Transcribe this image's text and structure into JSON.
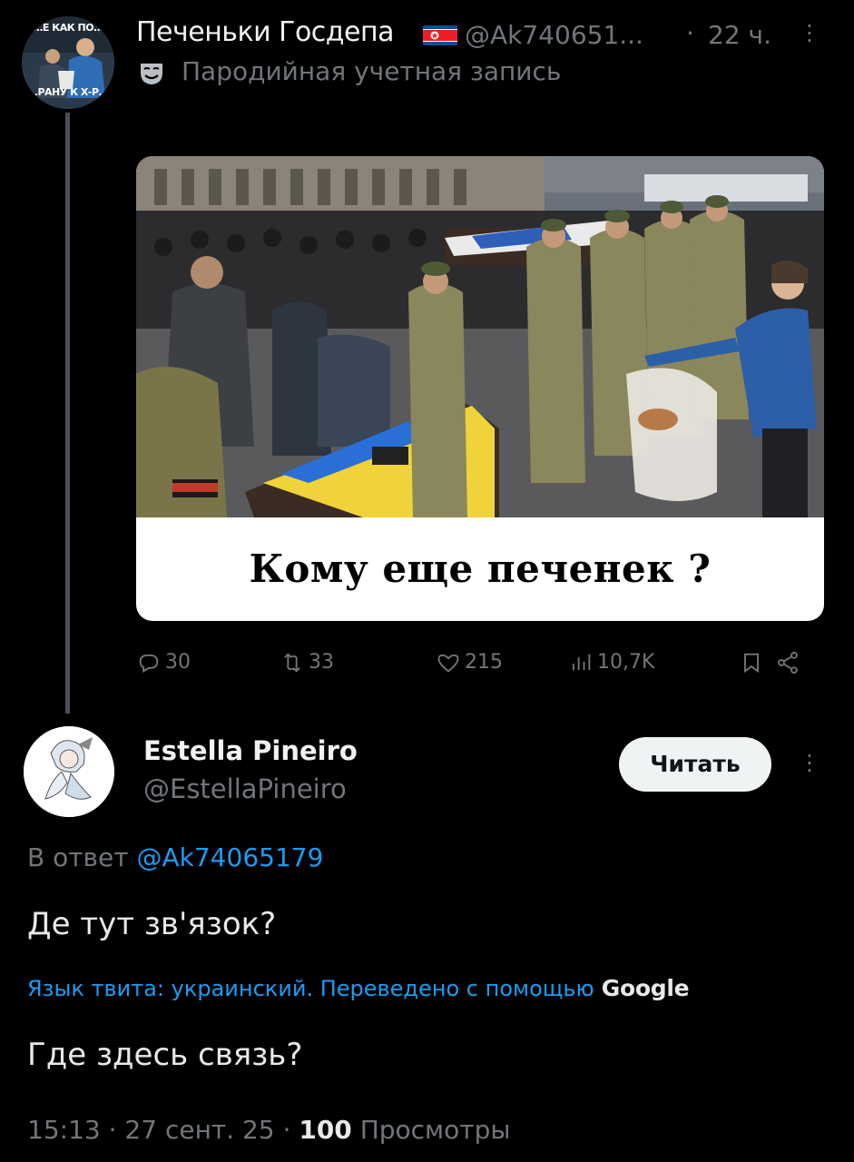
{
  "tweet": {
    "avatar_text_top": "…Е КАК ПО…",
    "avatar_text_bottom": "…РАНУ К Х-Р…",
    "author_name": "Печеньки Госдепа",
    "handle": "@Ak740651...",
    "dot": "·",
    "time": "22 ч.",
    "more_label": "⋮",
    "parody_label": "Пародийная учетная запись",
    "image_caption": "Кому еще печенек ?",
    "actions": {
      "replies": "30",
      "reposts": "33",
      "likes": "215",
      "views": "10,7K"
    }
  },
  "reply": {
    "author_name": "Estella Pineiro",
    "handle": "@EstellaPineiro",
    "follow_label": "Читать",
    "more_label": "⋮",
    "reply_prefix": "В ответ",
    "reply_mention": "@Ak74065179",
    "text": "Де тут зв'язок?",
    "translation_note": "Язык твита: украинский. Переведено с помощью",
    "translation_provider": "Google",
    "translated_text": "Где здесь связь?",
    "time": "15:13",
    "date": "27 сент. 25",
    "views_count": "100",
    "views_label": "Просмотры",
    "sep": "·"
  },
  "colors": {
    "background": "#000000",
    "secondary_text": "#71767b",
    "link": "#1d9bf0",
    "primary_text": "#e7e9ea",
    "follow_button_bg": "#eff3f4"
  },
  "icons": [
    "reply-icon",
    "repost-icon",
    "like-icon",
    "views-icon",
    "bookmark-icon",
    "share-icon",
    "parody-mask-icon",
    "more-icon"
  ]
}
